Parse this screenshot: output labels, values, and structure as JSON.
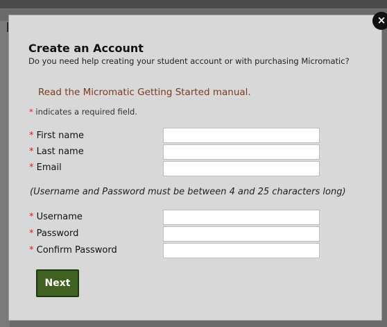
{
  "dialog": {
    "title": "Create an Account",
    "help_text": "Do you need help creating your student account or with purchasing Micromatic?",
    "manual_link": "Read the Micromatic Getting Started manual.",
    "required_star": "*",
    "required_note": "indicates a required field.",
    "close_glyph": "×",
    "fields_personal": [
      {
        "label": "First name",
        "value": ""
      },
      {
        "label": "Last name",
        "value": ""
      },
      {
        "label": "Email",
        "value": ""
      }
    ],
    "length_note": "(Username and Password must be between 4 and 25 characters long)",
    "fields_account": [
      {
        "label": "Username",
        "value": ""
      },
      {
        "label": "Password",
        "value": ""
      },
      {
        "label": "Confirm Password",
        "value": ""
      }
    ],
    "next_label": "Next"
  },
  "colors": {
    "required_star": "#e31b1b",
    "link": "#7d3b1f",
    "next_button": "#3f6220",
    "modal_bg": "#d8d8d8"
  },
  "icons": {
    "close": "close-icon"
  }
}
